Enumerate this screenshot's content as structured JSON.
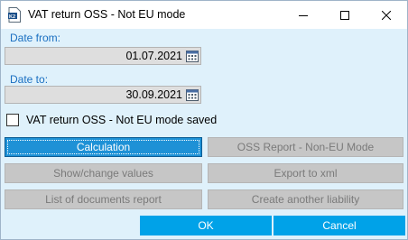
{
  "window": {
    "title": "VAT return OSS - Not EU mode",
    "icon": "app-icon",
    "controls": [
      "minimize-icon",
      "maximize-icon",
      "close-icon"
    ]
  },
  "form": {
    "date_from_label": "Date from:",
    "date_from_value": "01.07.2021",
    "date_to_label": "Date to:",
    "date_to_value": "30.09.2021",
    "saved_checkbox_label": "VAT return OSS - Not EU mode saved",
    "saved_checkbox_checked": false
  },
  "buttons": {
    "calculation": "Calculation",
    "oss_report": "OSS Report - Non-EU Mode",
    "show_change": "Show/change values",
    "export_xml": "Export to xml",
    "list_documents": "List of documents report",
    "create_liability": "Create another liability",
    "ok": "OK",
    "cancel": "Cancel"
  },
  "colors": {
    "accent": "#1e91d6",
    "primary_button": "#00a2e8",
    "label_blue": "#1a6fc1",
    "background": "#dff1fb",
    "disabled": "#c6c6c6"
  }
}
